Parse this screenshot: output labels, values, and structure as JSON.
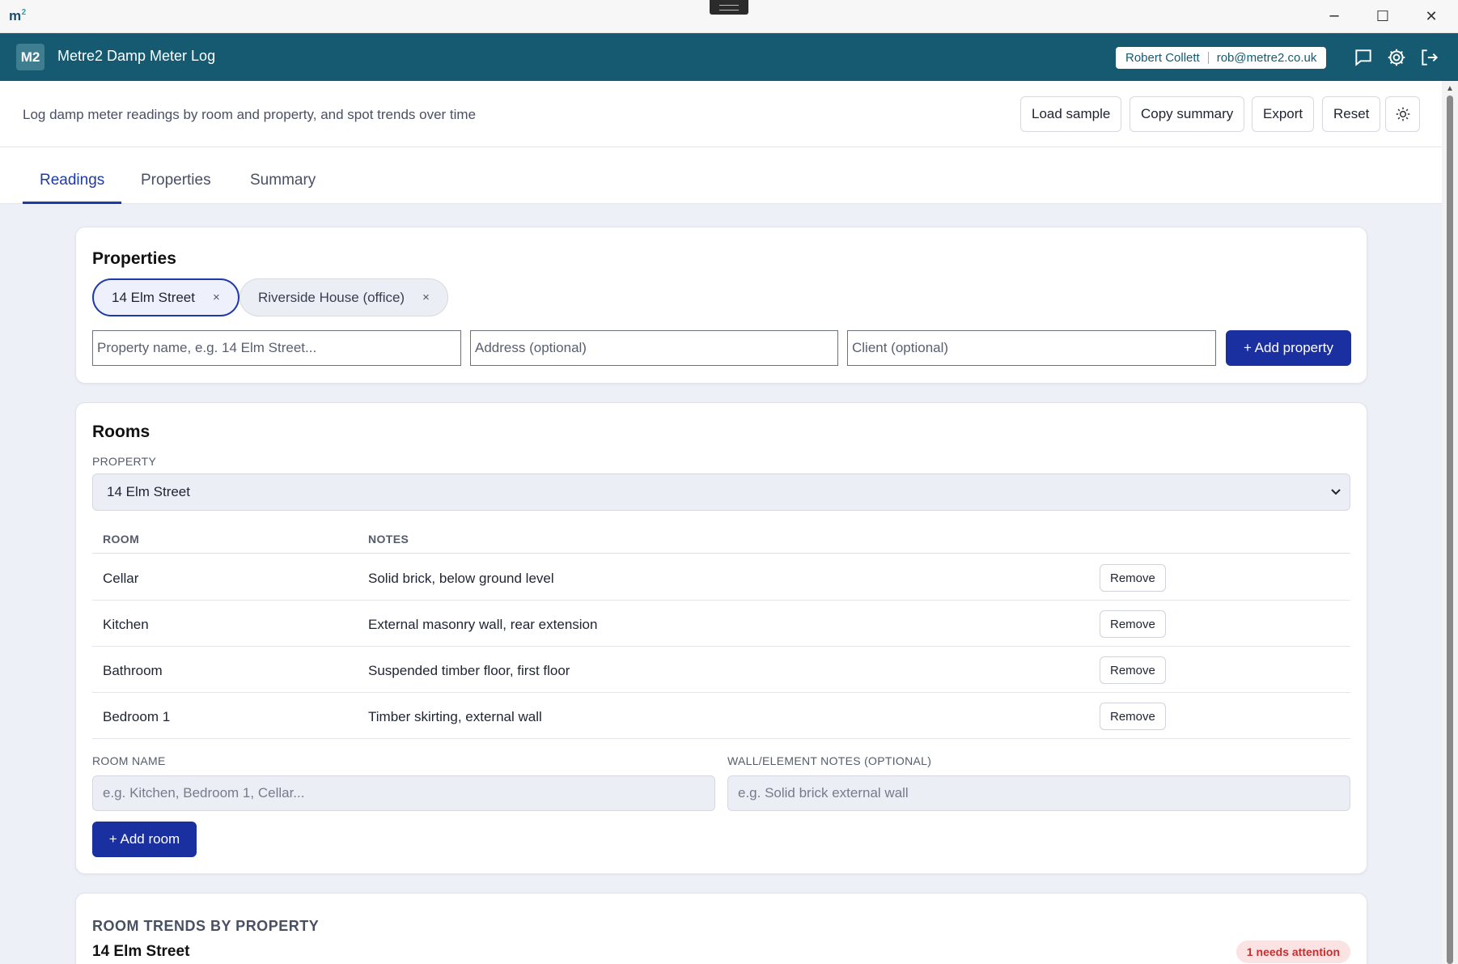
{
  "window": {
    "logo": "m",
    "logo_sup": "2",
    "minimize": "─",
    "maximize": "☐",
    "close": "✕"
  },
  "appbar": {
    "badge": "M2",
    "title": "Metre2 Damp Meter Log",
    "user_name": "Robert Collett",
    "user_email": "rob@metre2.co.uk",
    "icons": [
      "chat-icon",
      "gear-icon",
      "logout-icon"
    ]
  },
  "toolbar": {
    "subtitle": "Log damp meter readings by room and property, and spot trends over time",
    "load_sample": "Load sample",
    "copy_summary": "Copy summary",
    "export": "Export",
    "reset": "Reset",
    "theme_icon": "sun-icon"
  },
  "tabs": [
    {
      "label": "Readings",
      "active": true
    },
    {
      "label": "Properties",
      "active": false
    },
    {
      "label": "Summary",
      "active": false
    }
  ],
  "properties": {
    "heading": "Properties",
    "chips": [
      {
        "label": "14 Elm Street",
        "active": true,
        "remove": "×"
      },
      {
        "label": "Riverside House (office)",
        "active": false,
        "remove": "×"
      }
    ],
    "name_placeholder": "Property name, e.g. 14 Elm Street...",
    "address_placeholder": "Address (optional)",
    "client_placeholder": "Client (optional)",
    "add_button": "+ Add property"
  },
  "rooms": {
    "heading": "Rooms",
    "property_label": "PROPERTY",
    "selected_property": "14 Elm Street",
    "col_room": "ROOM",
    "col_notes": "NOTES",
    "rows": [
      {
        "room": "Cellar",
        "notes": "Solid brick, below ground level",
        "action": "Remove"
      },
      {
        "room": "Kitchen",
        "notes": "External masonry wall, rear extension",
        "action": "Remove"
      },
      {
        "room": "Bathroom",
        "notes": "Suspended timber floor, first floor",
        "action": "Remove"
      },
      {
        "room": "Bedroom 1",
        "notes": "Timber skirting, external wall",
        "action": "Remove"
      }
    ],
    "room_name_label": "ROOM NAME",
    "room_name_placeholder": "e.g. Kitchen, Bedroom 1, Cellar...",
    "notes_label": "WALL/ELEMENT NOTES (OPTIONAL)",
    "notes_placeholder": "e.g. Solid brick external wall",
    "add_button": "+ Add room"
  },
  "trends": {
    "heading": "ROOM TRENDS BY PROPERTY",
    "property": "14 Elm Street",
    "badge": "1 needs attention"
  },
  "colors": {
    "appbar": "#155a70",
    "accent": "#1a2fa0",
    "attention": "#c23030"
  }
}
